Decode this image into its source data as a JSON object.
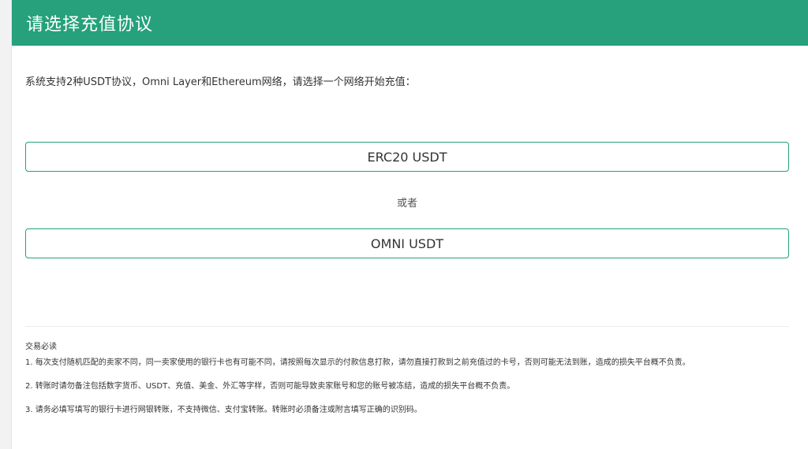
{
  "header": {
    "title": "请选择充值协议"
  },
  "intro": {
    "text": "系统支持2种USDT协议，Omni Layer和Ethereum网络，请选择一个网络开始充值："
  },
  "options": {
    "erc20_label": "ERC20 USDT",
    "or_label": "或者",
    "omni_label": "OMNI USDT"
  },
  "notice": {
    "title": "交易必读",
    "items": [
      "1. 每次支付随机匹配的卖家不同，同一卖家使用的银行卡也有可能不同，请按照每次显示的付款信息打款，请勿直接打款到之前充值过的卡号，否则可能无法到账，造成的损失平台概不负责。",
      "2. 转账时请勿备注包括数字货币、USDT、充值、美金、外汇等字样，否则可能导致卖家账号和您的账号被冻结，造成的损失平台概不负责。",
      "3. 请务必填写填写的银行卡进行网银转账，不支持微信、支付宝转账。转账时必须备注或附言填写正确的识别码。"
    ]
  },
  "colors": {
    "accent": "#26a17b",
    "background": "#f2f2f2",
    "panel": "#ffffff"
  }
}
